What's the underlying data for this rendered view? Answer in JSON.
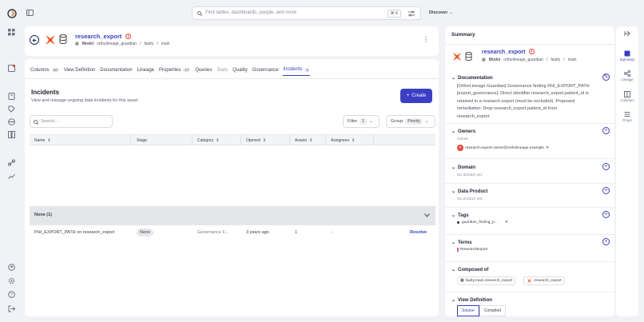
{
  "topbar": {
    "search_placeholder": "Find tables, dashboards, people, and more",
    "shortcut": "⌘ K",
    "discover": "Discover"
  },
  "header": {
    "title": "research_export",
    "type": "Model",
    "breadcrumbs": [
      "orthulineage_guardian",
      "faulty",
      "main"
    ]
  },
  "tabs": [
    {
      "label": "Columns",
      "badge": "10"
    },
    {
      "label": "View Definition"
    },
    {
      "label": "Documentation"
    },
    {
      "label": "Lineage"
    },
    {
      "label": "Properties",
      "badge": "17"
    },
    {
      "label": "Queries"
    },
    {
      "label": "Stats"
    },
    {
      "label": "Quality"
    },
    {
      "label": "Governance"
    },
    {
      "label": "Incidents",
      "badge": "1"
    }
  ],
  "incidents": {
    "title": "Incidents",
    "subtitle": "View and manage ongoing data incidents for this asset",
    "create_label": "Create",
    "search_placeholder": "Search...",
    "filter_label": "Filter",
    "filter_count": "1",
    "group_label": "Group",
    "group_value": "Priority",
    "columns": [
      "Name",
      "Stage",
      "Category",
      "Opened",
      "Assets",
      "Assignees"
    ],
    "group_row": "None (1)",
    "rows": [
      {
        "name": "PHI_EXPORT_PATH on research_export",
        "stage": "None",
        "category": "Governance F...",
        "opened": "3 years ago",
        "assets": "1",
        "assignees": "-",
        "action": "Resolve"
      }
    ]
  },
  "summary": {
    "heading": "Summary",
    "title": "research_export",
    "type": "Model",
    "breadcrumbs": [
      "orthulineage_guardian",
      "faulty",
      "main"
    ],
    "documentation": {
      "label": "Documentation",
      "lines": [
        "[OrthoLineage Guardian] Governance finding PHI_EXPORT_PATH",
        "[export_governance]: Direct identifier research_export.patient_id is",
        "retained in a research export (must be excluded). Proposed",
        "remediation: Drop research_export.patient_id from",
        "research_export."
      ]
    },
    "owners": {
      "label": "Owners",
      "sub": "Owner",
      "owner": "research-export-owner@ortholineage.example"
    },
    "domain": {
      "label": "Domain",
      "empty": "No domain yet."
    },
    "data_product": {
      "label": "Data Product",
      "empty": "No product yet."
    },
    "tags": {
      "label": "Tags",
      "tag": "guardian_finding_p..."
    },
    "terms": {
      "label": "Terms",
      "term": "ResearchExport"
    },
    "composed": {
      "label": "Composed of",
      "items": [
        "faulty.main.research_export",
        "research_export"
      ]
    },
    "view_def": {
      "label": "View Definition",
      "source": "Source",
      "compiled": "Compiled"
    }
  },
  "strip": [
    "Summary",
    "Lineage",
    "Columns",
    "Props"
  ],
  "colors": {
    "accent": "#3a3fb8",
    "create": "#3b3fc4",
    "error": "#e0463a"
  }
}
